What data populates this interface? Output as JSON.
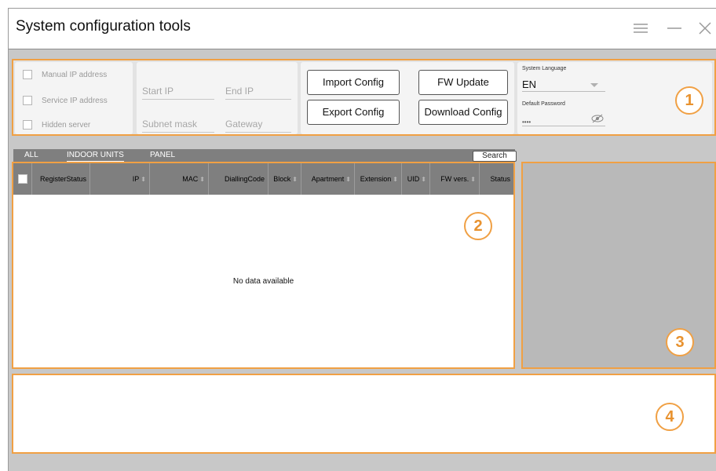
{
  "window": {
    "title": "System configuration tools"
  },
  "region1": {
    "checkboxes": [
      "Manual IP address",
      "Service IP address",
      "Hidden server"
    ],
    "ip_fields": {
      "start_ip": "Start IP",
      "end_ip": "End IP",
      "subnet_mask": "Subnet mask",
      "gateway": "Gateway"
    },
    "buttons": {
      "import": "Import Config",
      "export": "Export Config",
      "fw_update": "FW Update",
      "download": "Download Config"
    },
    "language": {
      "label": "System Language",
      "value": "EN"
    },
    "password": {
      "label": "Default Password",
      "value": "••••"
    }
  },
  "tabs": [
    {
      "label": "ALL",
      "active": false
    },
    {
      "label": "INDOOR UNITS",
      "active": true
    },
    {
      "label": "PANEL",
      "active": false
    }
  ],
  "search_label": "Search",
  "table": {
    "columns": [
      "RegisterStatus",
      "IP",
      "MAC",
      "DiallingCode",
      "Block",
      "Apartment",
      "Extension",
      "UID",
      "FW vers.",
      "Status"
    ],
    "empty_text": "No data available"
  },
  "badges": [
    "1",
    "2",
    "3",
    "4"
  ],
  "colors": {
    "highlight": "#f0a044",
    "header": "#7f7f7f"
  }
}
